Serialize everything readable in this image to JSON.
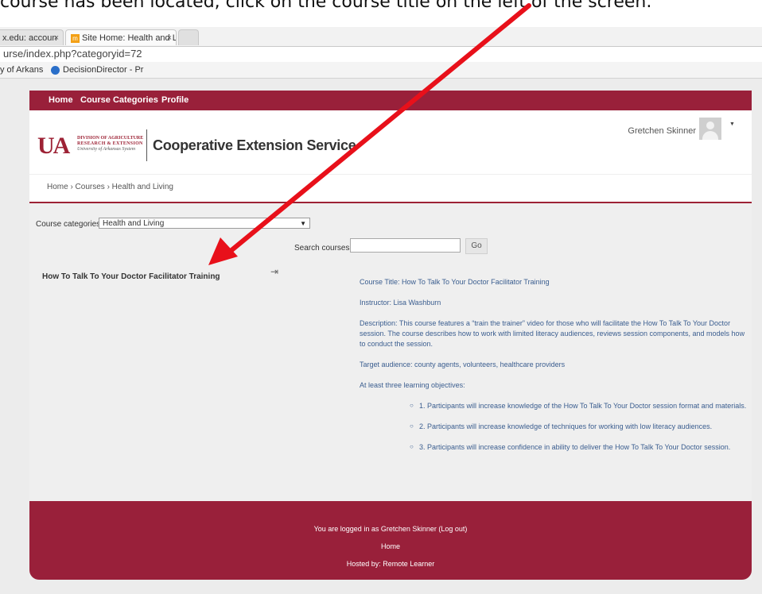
{
  "caption": "course has been located, click on the course title on the left of the screen.",
  "browser": {
    "tabs": [
      {
        "label": "x.edu: accoun"
      },
      {
        "label": "Site Home: Health and Li"
      },
      {
        "label": ""
      }
    ],
    "url": "urse/index.php?categoryid=72",
    "bookmarks": [
      "y of Arkans",
      "DecisionDirector - Pr"
    ]
  },
  "nav": {
    "items": [
      "Home",
      "Course Categories",
      "Profile"
    ]
  },
  "header": {
    "ua_logo": "UA",
    "division_line1": "DIVISION OF AGRICULTURE",
    "division_line2": "RESEARCH & EXTENSION",
    "division_line3": "University of Arkansas System",
    "site_name": "Cooperative Extension Service",
    "user_name": "Gretchen Skinner"
  },
  "breadcrumb": "Home › Courses › Health and Living",
  "category": {
    "label": "Course categories:",
    "selected": "Health and Living"
  },
  "search": {
    "label": "Search courses:",
    "value": "",
    "button": "Go"
  },
  "course": {
    "title": "How To Talk To Your Doctor Facilitator Training",
    "summary_title": "Course Title: How To Talk To Your Doctor Facilitator Training",
    "instructor": "Instructor: Lisa Washburn",
    "description": "Description: This course features a “train the trainer” video for those who will facilitate the How To Talk To Your Doctor session. The course describes how to work with limited literacy audiences, reviews session components, and models how to conduct the session.",
    "audience": "Target audience: county agents, volunteers, healthcare providers",
    "objectives_heading": "At least three learning objectives:",
    "objectives": [
      "1. Participants will increase knowledge of the How To Talk To Your Doctor session format and materials.",
      "2. Participants will increase knowledge of techniques for working with low literacy audiences.",
      "3. Participants will increase confidence in ability to deliver the How To Talk To Your Doctor session."
    ]
  },
  "footer": {
    "logged_in": "You are logged in as Gretchen Skinner (Log out)",
    "home": "Home",
    "hosted": "Hosted by: Remote Learner"
  },
  "colors": {
    "brand": "#99203a",
    "link": "#3a5d8f",
    "annotation_arrow": "#e8101a"
  },
  "icons": {
    "enrol": "enrol-icon",
    "avatar": "user-avatar-icon",
    "go": "search-button"
  }
}
